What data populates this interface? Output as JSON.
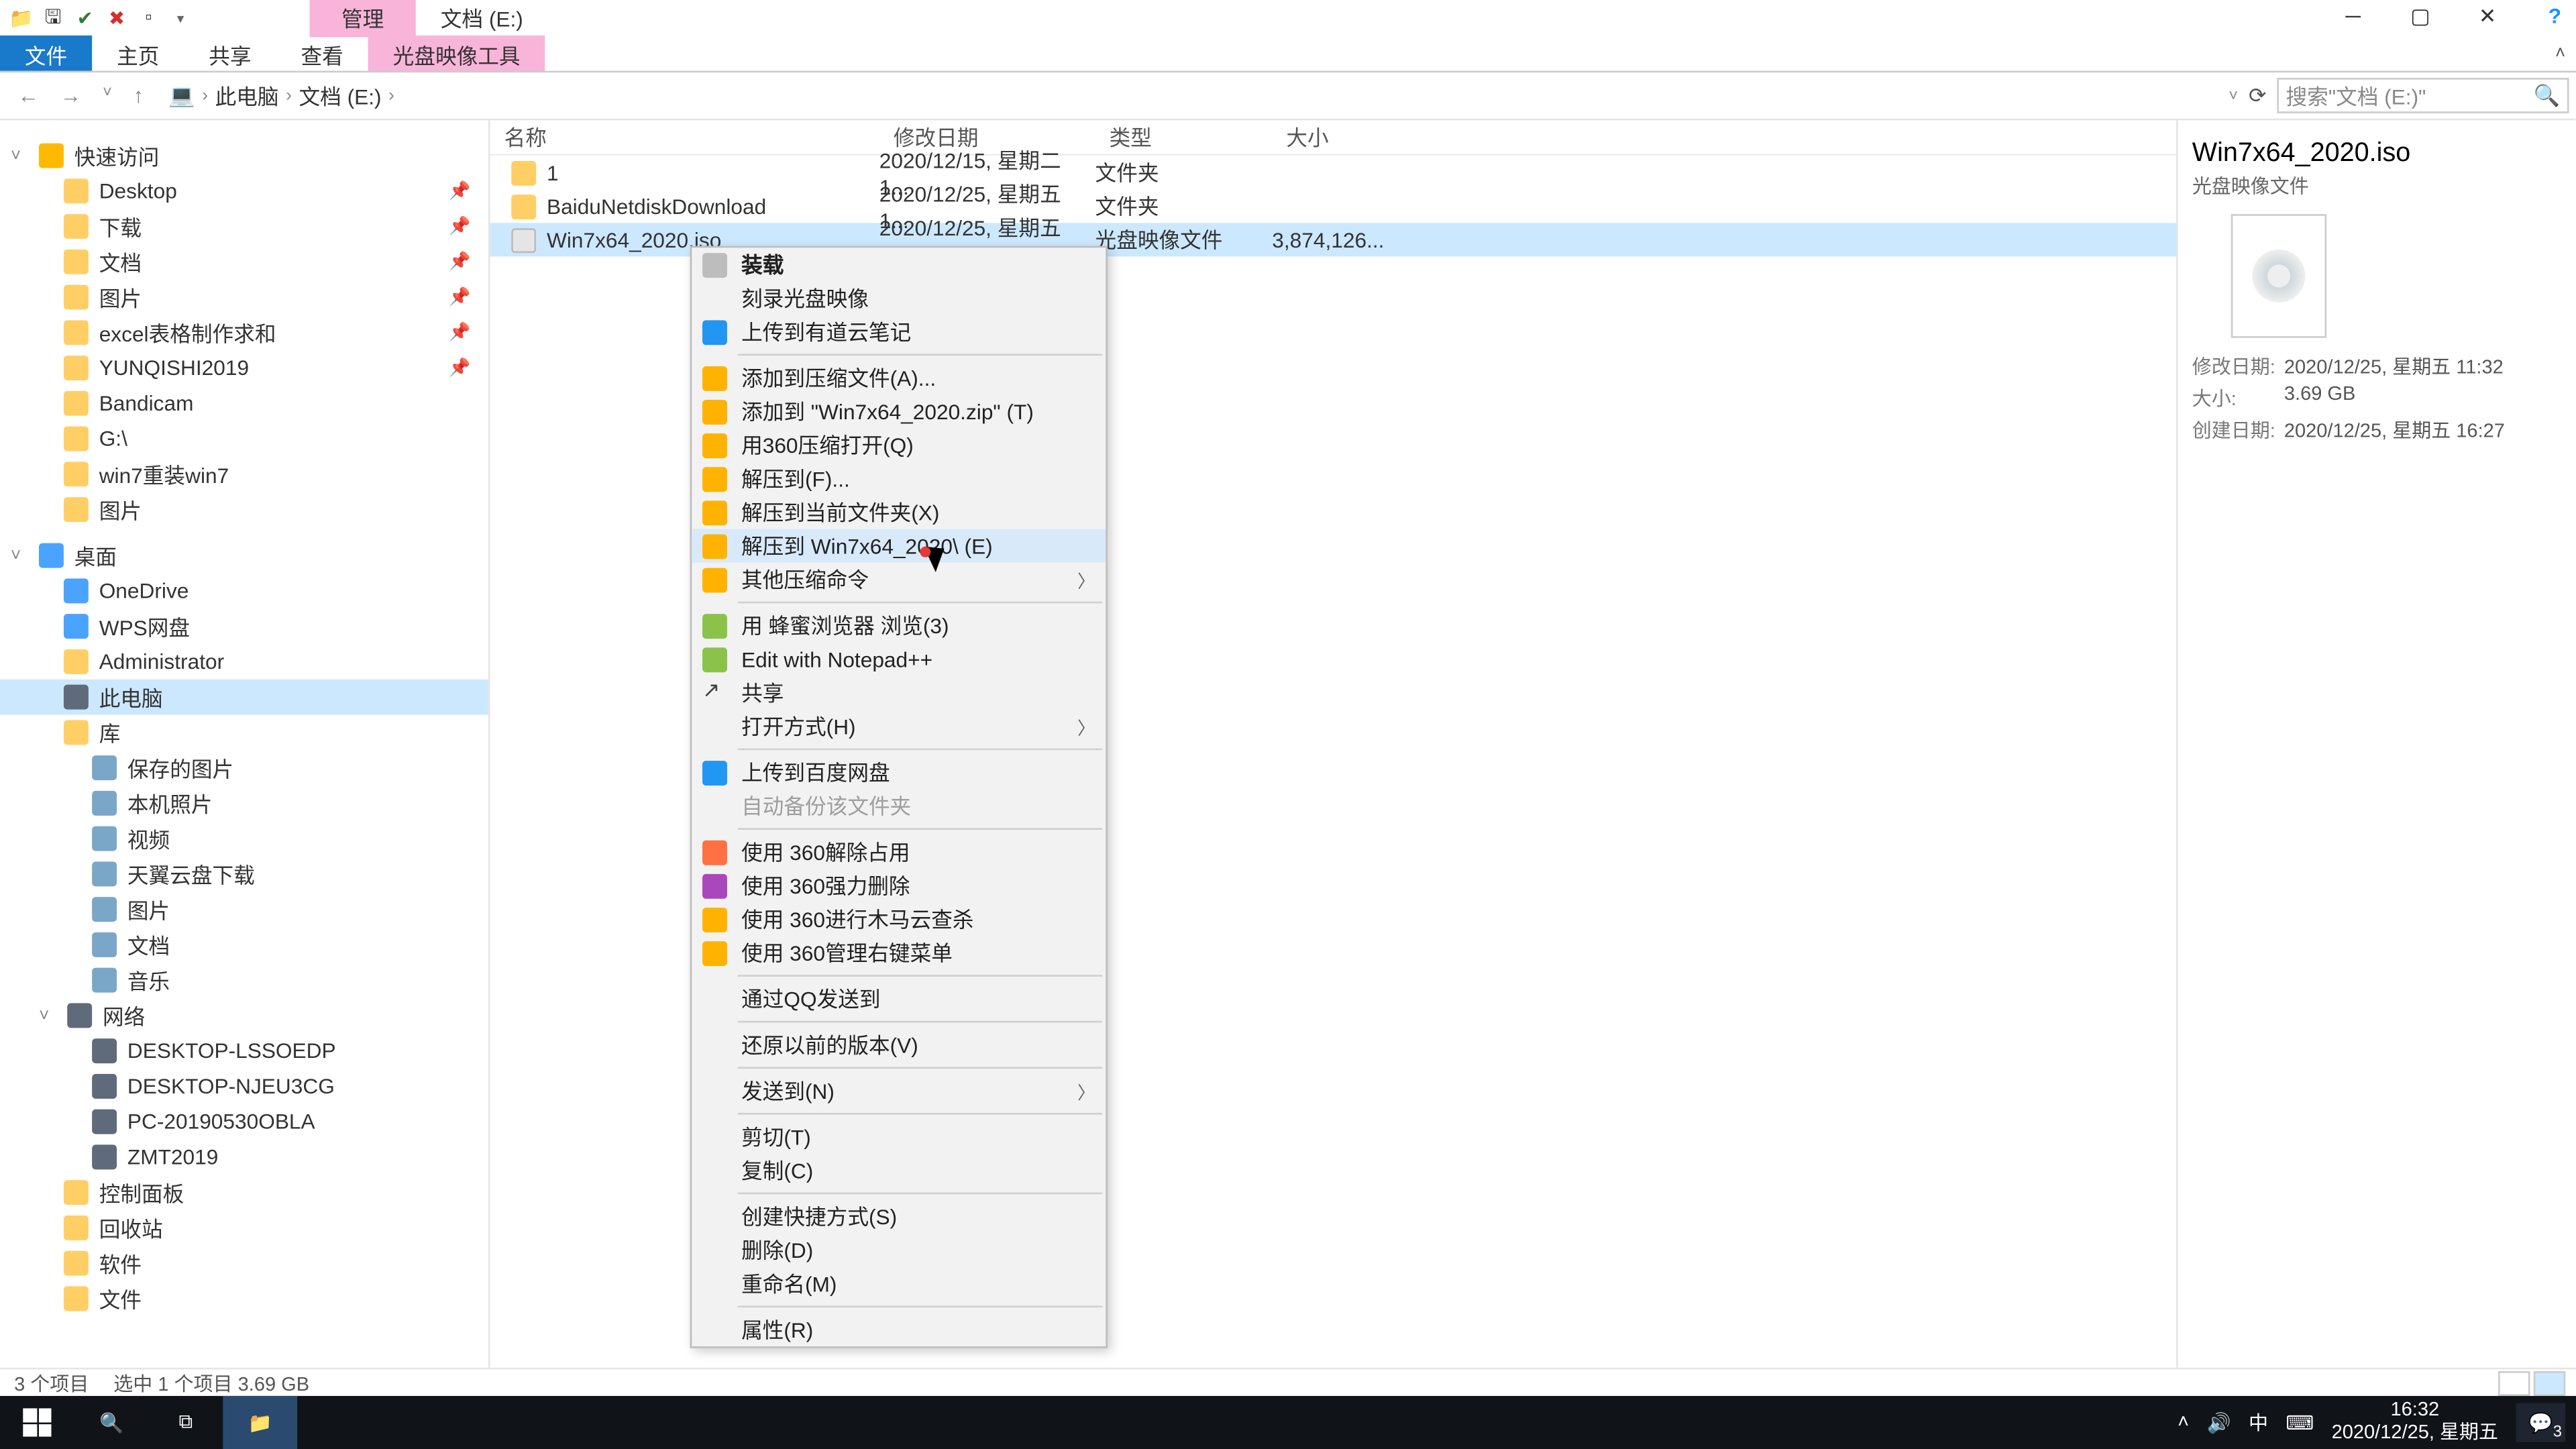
{
  "title_context_tab": "管理",
  "title_path": "文档 (E:)",
  "ribbon": {
    "file": "文件",
    "home": "主页",
    "share": "共享",
    "view": "查看",
    "ctx": "光盘映像工具"
  },
  "breadcrumb": {
    "pc": "此电脑",
    "loc": "文档 (E:)"
  },
  "search_placeholder": "搜索\"文档 (E:)\"",
  "tree": {
    "quick": "快速访问",
    "quick_items": [
      "Desktop",
      "下载",
      "文档",
      "图片",
      "excel表格制作求和",
      "YUNQISHI2019",
      "Bandicam",
      "G:\\",
      "win7重装win7",
      "图片"
    ],
    "pins": [
      true,
      true,
      true,
      true,
      true,
      true,
      false,
      false,
      false,
      false
    ],
    "desktop": "桌面",
    "desktop_items": [
      "OneDrive",
      "WPS网盘",
      "Administrator",
      "此电脑",
      "库"
    ],
    "lib_items": [
      "保存的图片",
      "本机照片",
      "视频",
      "天翼云盘下载",
      "图片",
      "文档",
      "音乐"
    ],
    "network": "网络",
    "net_items": [
      "DESKTOP-LSSOEDP",
      "DESKTOP-NJEU3CG",
      "PC-20190530OBLA",
      "ZMT2019"
    ],
    "tail": [
      "控制面板",
      "回收站",
      "软件",
      "文件"
    ]
  },
  "columns": {
    "name": "名称",
    "date": "修改日期",
    "type": "类型",
    "size": "大小"
  },
  "rows": [
    {
      "name": "1",
      "date": "2020/12/15, 星期二 1...",
      "type": "文件夹",
      "size": "",
      "folder": true
    },
    {
      "name": "BaiduNetdiskDownload",
      "date": "2020/12/25, 星期五 1...",
      "type": "文件夹",
      "size": "",
      "folder": true
    },
    {
      "name": "Win7x64_2020.iso",
      "date": "2020/12/25, 星期五 1...",
      "type": "光盘映像文件",
      "size": "3,874,126...",
      "folder": false,
      "selected": true
    }
  ],
  "preview": {
    "title": "Win7x64_2020.iso",
    "sub": "光盘映像文件",
    "mod_k": "修改日期:",
    "mod_v": "2020/12/25, 星期五 11:32",
    "size_k": "大小:",
    "size_v": "3.69 GB",
    "create_k": "创建日期:",
    "create_v": "2020/12/25, 星期五 16:27"
  },
  "status": {
    "items": "3 个项目",
    "sel": "选中 1 个项目  3.69 GB"
  },
  "ctx_menu": [
    {
      "t": "装载",
      "bold": true,
      "ic": "ic-cd"
    },
    {
      "t": "刻录光盘映像"
    },
    {
      "t": "上传到有道云笔记",
      "ic": "ic-b"
    },
    {
      "sep": true
    },
    {
      "t": "添加到压缩文件(A)...",
      "ic": "ic-y"
    },
    {
      "t": "添加到 \"Win7x64_2020.zip\" (T)",
      "ic": "ic-y"
    },
    {
      "t": "用360压缩打开(Q)",
      "ic": "ic-y"
    },
    {
      "t": "解压到(F)...",
      "ic": "ic-y"
    },
    {
      "t": "解压到当前文件夹(X)",
      "ic": "ic-y"
    },
    {
      "t": "解压到 Win7x64_2020\\ (E)",
      "ic": "ic-y",
      "hov": true
    },
    {
      "t": "其他压缩命令",
      "ic": "ic-y",
      "sub": true
    },
    {
      "sep": true
    },
    {
      "t": "用 蜂蜜浏览器 浏览(3)",
      "ic": "ic-g"
    },
    {
      "t": "Edit with Notepad++",
      "ic": "ic-g"
    },
    {
      "t": "共享",
      "ic": "ic-share"
    },
    {
      "t": "打开方式(H)",
      "sub": true
    },
    {
      "sep": true
    },
    {
      "t": "上传到百度网盘",
      "ic": "ic-b"
    },
    {
      "t": "自动备份该文件夹",
      "dis": true
    },
    {
      "sep": true
    },
    {
      "t": "使用 360解除占用",
      "ic": "ic-o"
    },
    {
      "t": "使用 360强力删除",
      "ic": "ic-p"
    },
    {
      "t": "使用 360进行木马云查杀",
      "ic": "ic-y"
    },
    {
      "t": "使用 360管理右键菜单",
      "ic": "ic-y"
    },
    {
      "sep": true
    },
    {
      "t": "通过QQ发送到"
    },
    {
      "sep": true
    },
    {
      "t": "还原以前的版本(V)"
    },
    {
      "sep": true
    },
    {
      "t": "发送到(N)",
      "sub": true
    },
    {
      "sep": true
    },
    {
      "t": "剪切(T)"
    },
    {
      "t": "复制(C)"
    },
    {
      "sep": true
    },
    {
      "t": "创建快捷方式(S)"
    },
    {
      "t": "删除(D)"
    },
    {
      "t": "重命名(M)"
    },
    {
      "sep": true
    },
    {
      "t": "属性(R)"
    }
  ],
  "taskbar": {
    "ime": "中",
    "time": "16:32",
    "date": "2020/12/25, 星期五",
    "notif_count": "3"
  }
}
